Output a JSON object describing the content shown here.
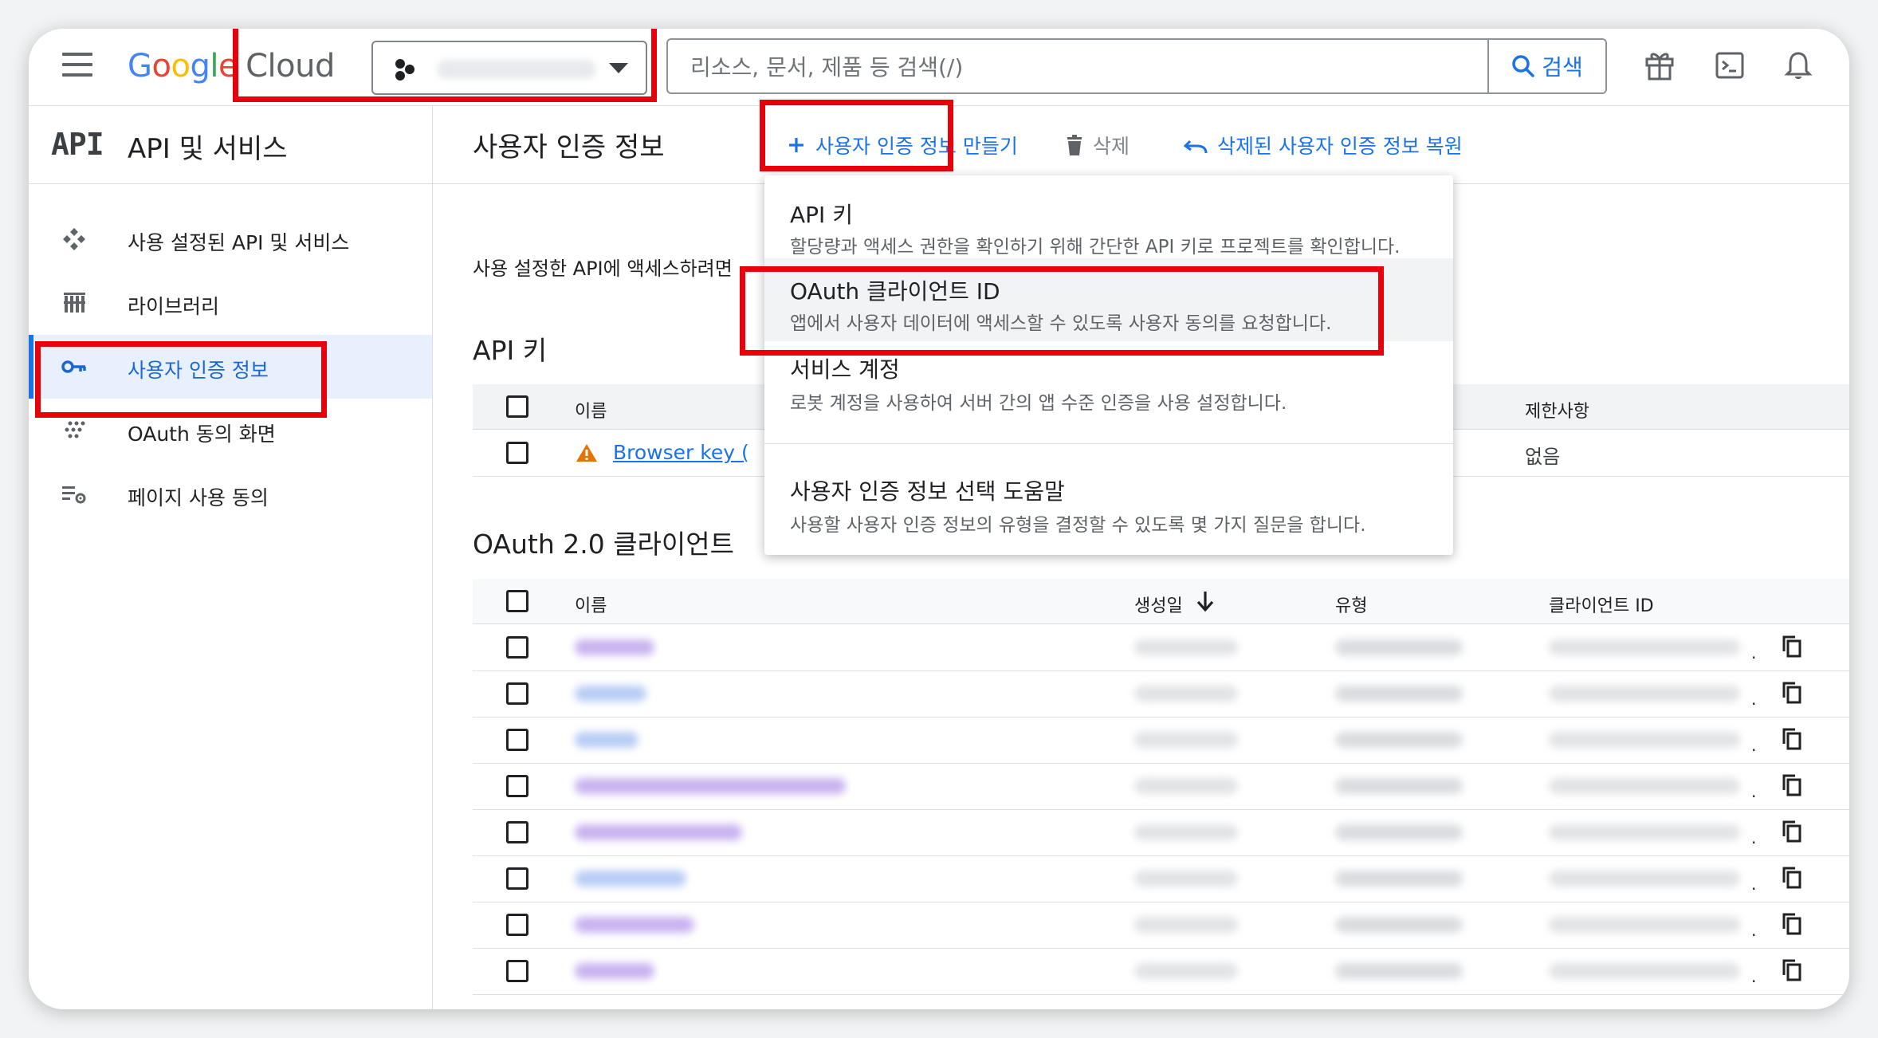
{
  "app": {
    "logo_text": "Google",
    "logo_product": "Cloud"
  },
  "search": {
    "placeholder": "리소스, 문서, 제품 등 검색(/)",
    "button_label": "검색"
  },
  "sidebar": {
    "product_icon": "API",
    "title": "API 및 서비스",
    "items": [
      {
        "label": "사용 설정된 API 및 서비스",
        "icon": "api-diamond-icon"
      },
      {
        "label": "라이브러리",
        "icon": "library-icon"
      },
      {
        "label": "사용자 인증 정보",
        "icon": "key-icon",
        "active": true
      },
      {
        "label": "OAuth 동의 화면",
        "icon": "oauth-dots-icon"
      },
      {
        "label": "페이지 사용 동의",
        "icon": "settings-list-icon"
      }
    ]
  },
  "main": {
    "title": "사용자 인증 정보",
    "actions": {
      "create": "사용자 인증 정보 만들기",
      "delete": "삭제",
      "restore": "삭제된 사용자 인증 정보 복원"
    },
    "description": "사용 설정한 API에 액세스하려면",
    "api_keys": {
      "heading": "API 키",
      "columns": {
        "name": "이름",
        "restrictions": "제한사항"
      },
      "rows": [
        {
          "name": "Browser key (",
          "restrictions": "없음"
        }
      ]
    },
    "oauth": {
      "heading": "OAuth 2.0 클라이언트",
      "columns": {
        "name": "이름",
        "created": "생성일",
        "type": "유형",
        "client_id": "클라이언트 ID"
      },
      "row_suffix": "."
    }
  },
  "create_menu": {
    "items": [
      {
        "title": "API 키",
        "description": "할당량과 액세스 권한을 확인하기 위해 간단한 API 키로 프로젝트를 확인합니다."
      },
      {
        "title": "OAuth 클라이언트 ID",
        "description": "앱에서 사용자 데이터에 액세스할 수 있도록 사용자 동의를 요청합니다."
      },
      {
        "title": "서비스 계정",
        "description": "로봇 계정을 사용하여 서버 간의 앱 수준 인증을 사용 설정합니다."
      },
      {
        "title": "사용자 인증 정보 선택 도움말",
        "description": "사용할 사용자 인증 정보의 유형을 결정할 수 있도록 몇 가지 질문을 합니다."
      }
    ]
  },
  "colors": {
    "accent": "#1a73e8",
    "highlight_box": "#e8000b",
    "warning": "#e37400"
  }
}
